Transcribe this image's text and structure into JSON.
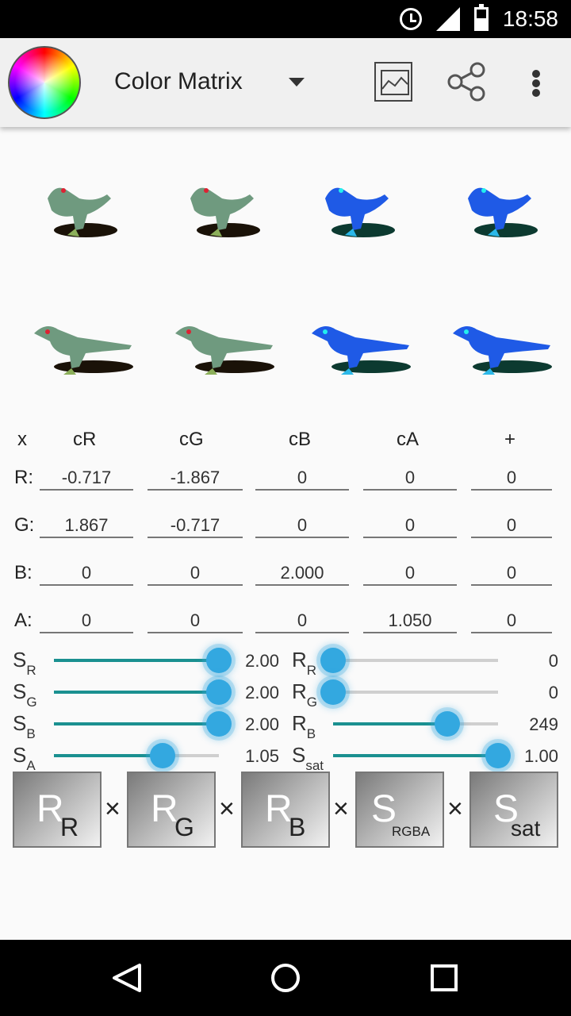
{
  "status_bar": {
    "time": "18:58",
    "icons": [
      "alarm-icon",
      "signal-icon",
      "battery-icon"
    ]
  },
  "app_bar": {
    "title": "Color Matrix",
    "icons": [
      "color-wheel-logo",
      "dropdown-arrow-icon",
      "image-icon",
      "share-icon",
      "more-vert-icon"
    ]
  },
  "matrix": {
    "headers": [
      "x",
      "cR",
      "cG",
      "cB",
      "cA",
      "+"
    ],
    "rows": [
      {
        "label": "R:",
        "values": [
          "-0.717",
          "-1.867",
          "0",
          "0",
          "0"
        ]
      },
      {
        "label": "G:",
        "values": [
          "1.867",
          "-0.717",
          "0",
          "0",
          "0"
        ]
      },
      {
        "label": "B:",
        "values": [
          "0",
          "0",
          "2.000",
          "0",
          "0"
        ]
      },
      {
        "label": "A:",
        "values": [
          "0",
          "0",
          "0",
          "1.050",
          "0"
        ]
      }
    ]
  },
  "sliders": {
    "left": [
      {
        "main": "S",
        "sub": "R",
        "value": "2.00",
        "fraction": 1.0
      },
      {
        "main": "S",
        "sub": "G",
        "value": "2.00",
        "fraction": 1.0
      },
      {
        "main": "S",
        "sub": "B",
        "value": "2.00",
        "fraction": 1.0
      },
      {
        "main": "S",
        "sub": "A",
        "value": "1.05",
        "fraction": 0.66
      }
    ],
    "right": [
      {
        "main": "R",
        "sub": "R",
        "value": "0",
        "fraction": 0.0
      },
      {
        "main": "R",
        "sub": "G",
        "value": "0",
        "fraction": 0.0
      },
      {
        "main": "R",
        "sub": "B",
        "value": "249",
        "fraction": 0.69
      },
      {
        "main": "S",
        "sub": "sat",
        "value": "1.00",
        "fraction": 1.0
      }
    ]
  },
  "factors": [
    {
      "main": "R",
      "sub": "R"
    },
    {
      "main": "R",
      "sub": "G"
    },
    {
      "main": "R",
      "sub": "B"
    },
    {
      "main": "S",
      "sub": "RGBA"
    },
    {
      "main": "S",
      "sub": "sat"
    }
  ],
  "times_symbol": "×",
  "colors": {
    "accent": "#1a9090",
    "thumb": "#33a8e0",
    "dino_green": "#6f9a7f",
    "dino_blue": "#1f5ae6"
  },
  "nav_bar": {
    "icons": [
      "back-icon",
      "home-icon",
      "recents-icon"
    ]
  }
}
